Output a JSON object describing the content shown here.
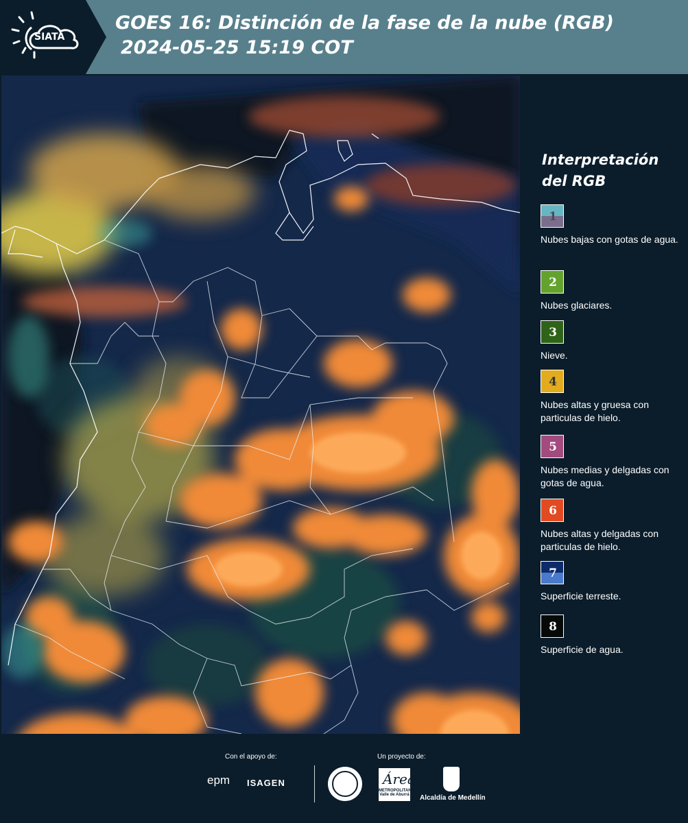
{
  "header": {
    "logo_text": "SIATA",
    "title_line1": "GOES 16: Distinción de la fase de la nube (RGB)",
    "title_line2": "2024-05-25 15:19 COT",
    "background_color": "#58808c"
  },
  "map": {
    "description_icon": "satellite-rgb-map",
    "colors": {
      "cloud_orange": "#f08a38",
      "cloud_yellow": "#c9b84a",
      "land": "#13294a",
      "water": "#070c14",
      "border": "#ffffff"
    }
  },
  "legend": {
    "title": "Interpretación del RGB",
    "items": [
      {
        "number": "1",
        "label": "Nubes bajas con gotas de agua.",
        "color_top": "#67b6c4",
        "color_bottom": "#7a6e8c",
        "number_color": "#4a4a5a"
      },
      {
        "number": "2",
        "label": "Nubes glaciares.",
        "color_top": "#64a22e",
        "color_bottom": "#64a22e",
        "number_color": "#ffffff"
      },
      {
        "number": "3",
        "label": "Nieve.",
        "color_top": "#2f6418",
        "color_bottom": "#2f6418",
        "number_color": "#ffffff"
      },
      {
        "number": "4",
        "label": "Nubes altas y gruesa con particulas de hielo.",
        "color_top": "#e2ac1e",
        "color_bottom": "#e2ac1e",
        "number_color": "#333333"
      },
      {
        "number": "5",
        "label": "Nubes medias y delgadas con gotas de agua.",
        "color_top": "#a34a7e",
        "color_bottom": "#a34a7e",
        "number_color": "#ffffff"
      },
      {
        "number": "6",
        "label": "Nubes altas y delgadas con particulas de hielo.",
        "color_top": "#e24a22",
        "color_bottom": "#e24a22",
        "number_color": "#ffffff"
      },
      {
        "number": "7",
        "label": "Superficie terreste.",
        "color_top": "#0d2a6a",
        "color_bottom": "#4a7acc",
        "number_color": "#ffffff"
      },
      {
        "number": "8",
        "label": "Superficie de agua.",
        "color_top": "#050a08",
        "color_bottom": "#050a08",
        "number_color": "#ffffff"
      }
    ]
  },
  "footer": {
    "support_label": "Con el apoyo de:",
    "project_label": "Un proyecto de:",
    "sponsor_1": "epm",
    "sponsor_2": "ISAGEN",
    "partner_metro_script": "Área",
    "partner_metro_text": "METROPOLITANA Valle de Aburrá",
    "partner_alcaldia": "Alcaldía de Medellín"
  }
}
